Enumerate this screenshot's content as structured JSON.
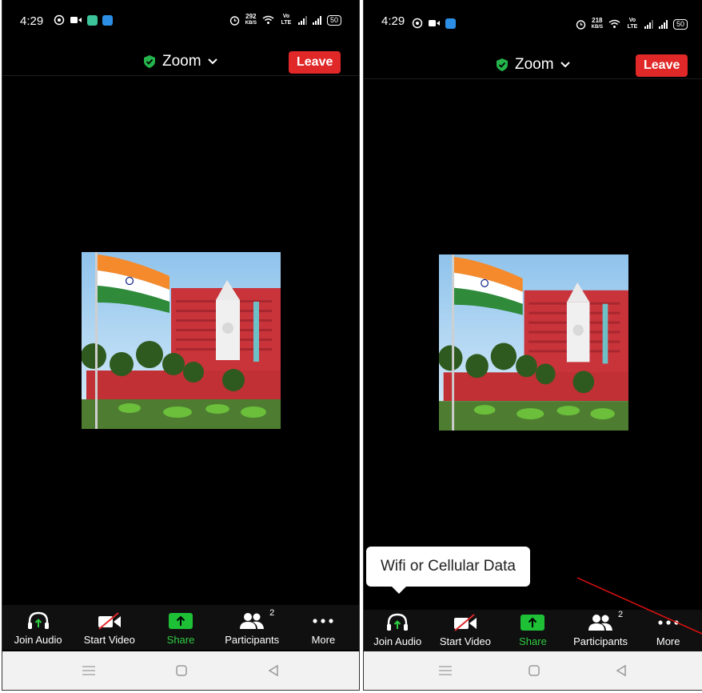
{
  "screens": [
    {
      "status": {
        "time": "4:29",
        "speed": "292",
        "speed_unit": "KB/S",
        "volte": "Vo LTE",
        "battery": "50"
      },
      "header": {
        "title": "Zoom",
        "leave_label": "Leave"
      },
      "toolbar": {
        "join_audio": "Join Audio",
        "start_video": "Start Video",
        "share": "Share",
        "participants": "Participants",
        "participants_count": "2",
        "more": "More"
      }
    },
    {
      "status": {
        "time": "4:29",
        "speed": "218",
        "speed_unit": "KB/S",
        "volte": "Vo LTE",
        "battery": "50"
      },
      "header": {
        "title": "Zoom",
        "leave_label": "Leave"
      },
      "tooltip": "Wifi or Cellular Data",
      "toolbar": {
        "join_audio": "Join Audio",
        "start_video": "Start Video",
        "share": "Share",
        "participants": "Participants",
        "participants_count": "2",
        "more": "More"
      }
    }
  ],
  "colors": {
    "leave": "#e02828",
    "share": "#1ec036",
    "shield": "#25b34b",
    "annotation_arrow": "#e01010"
  },
  "icons": [
    "whatsapp-icon",
    "video-icon",
    "app-icon",
    "alarm-icon",
    "wifi-icon",
    "signal-icon",
    "battery-icon",
    "shield-icon",
    "chevron-down-icon",
    "headphones-icon",
    "video-off-icon",
    "share-arrow-icon",
    "participants-icon",
    "more-icon",
    "menu-icon",
    "home-icon",
    "back-icon"
  ]
}
